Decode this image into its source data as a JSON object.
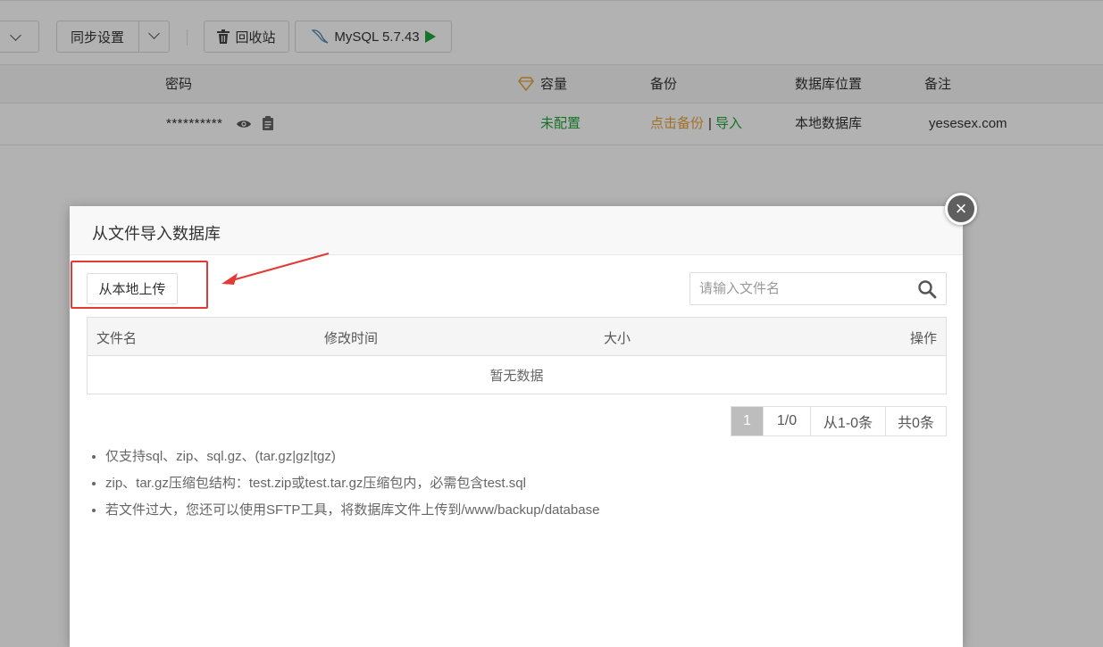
{
  "toolbar": {
    "sync_label": "同步设置",
    "recycle_label": "回收站",
    "mysql_label": "MySQL 5.7.43"
  },
  "table": {
    "headers": {
      "password": "密码",
      "capacity": "容量",
      "backup": "备份",
      "location": "数据库位置",
      "note": "备注"
    },
    "row": {
      "password": "**********",
      "capacity": "未配置",
      "backup_action": "点击备份",
      "backup_sep": "|",
      "import_action": "导入",
      "location": "本地数据库",
      "note": "yesesex.com"
    }
  },
  "modal": {
    "title": "从文件导入数据库",
    "upload_label": "从本地上传",
    "search_placeholder": "请输入文件名",
    "columns": [
      "文件名",
      "修改时间",
      "大小",
      "操作"
    ],
    "empty_text": "暂无数据",
    "pager": {
      "current": "1",
      "pages": "1/0",
      "range": "从1-0条",
      "total": "共0条"
    },
    "tips": [
      "仅支持sql、zip、sql.gz、(tar.gz|gz|tgz)",
      "zip、tar.gz压缩包结构：test.zip或test.tar.gz压缩包内，必需包含test.sql",
      "若文件过大，您还可以使用SFTP工具，将数据库文件上传到/www/backup/database"
    ]
  },
  "colors": {
    "accent_green": "#20a53a",
    "accent_orange": "#e6a23c",
    "highlight_red": "#e53935"
  },
  "icons": [
    "chevron-down-icon",
    "trash-icon",
    "mysql-dolphin-icon",
    "play-icon",
    "diamond-icon",
    "eye-icon",
    "copy-icon",
    "close-icon",
    "search-icon",
    "red-arrow-annotation"
  ]
}
